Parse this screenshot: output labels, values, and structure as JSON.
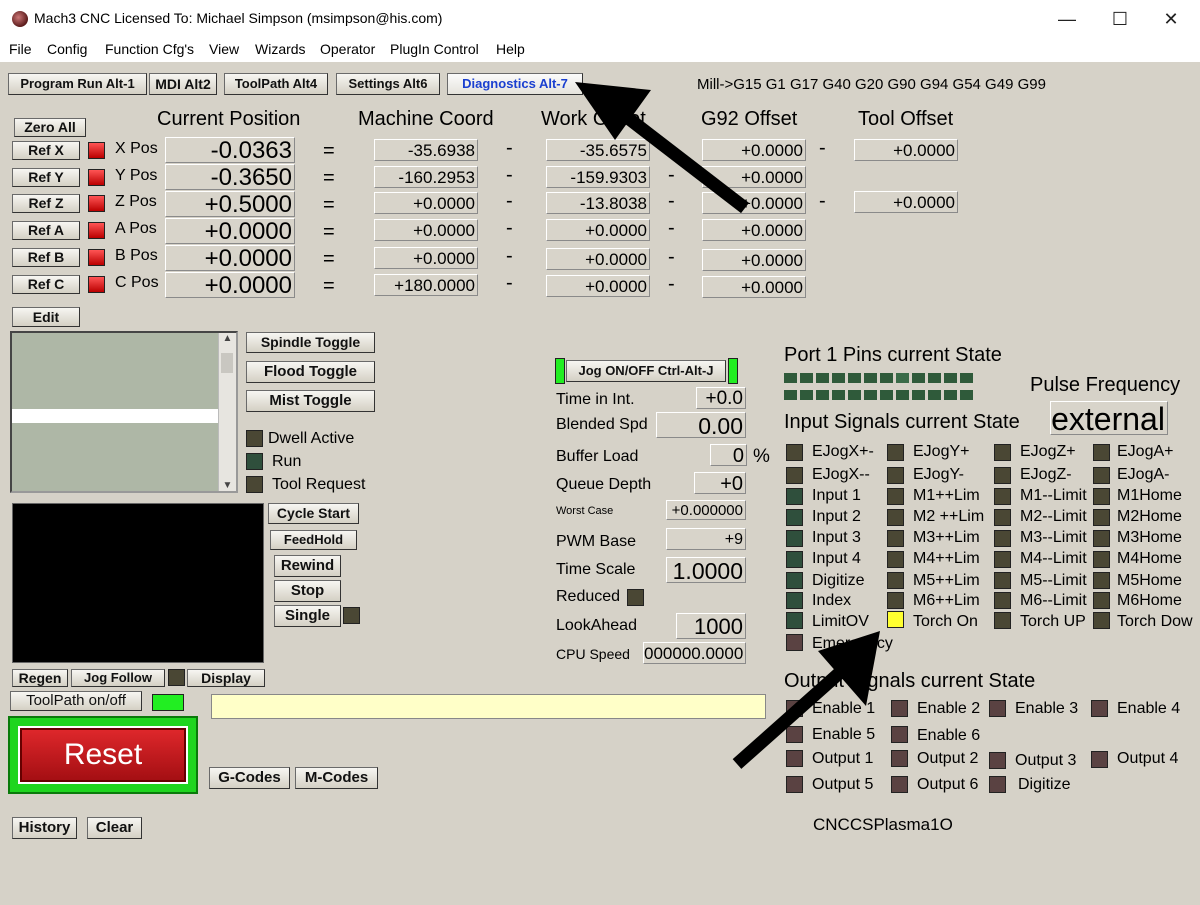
{
  "window": {
    "title": "Mach3 CNC  Licensed To:  Michael Simpson (msimpson@his.com)",
    "minimize": "—",
    "maximize": "☐",
    "close": "✕"
  },
  "menu": [
    "File",
    "Config",
    "Function Cfg's",
    "View",
    "Wizards",
    "Operator",
    "PlugIn Control",
    "Help"
  ],
  "tabs": [
    "Program Run Alt-1",
    "MDI Alt2",
    "ToolPath Alt4",
    "Settings Alt6",
    "Diagnostics Alt-7"
  ],
  "gcode_state": "Mill->G15  G1 G17 G40 G20 G90 G94 G54 G49 G99",
  "headers": {
    "current_position": "Current Position",
    "machine_coord": "Machine Coord",
    "work_offset": "Work Offset",
    "g92_offset": "G92 Offset",
    "tool_offset": "Tool Offset"
  },
  "zero_all": "Zero All",
  "axes": [
    {
      "ref": "Ref X",
      "label": "X Pos",
      "pos": "-0.0363",
      "machine": "-35.6938",
      "work": "-35.6575",
      "g92": "+0.0000",
      "tool": "+0.0000"
    },
    {
      "ref": "Ref Y",
      "label": "Y Pos",
      "pos": "-0.3650",
      "machine": "-160.2953",
      "work": "-159.9303",
      "g92": "+0.0000",
      "tool": ""
    },
    {
      "ref": "Ref Z",
      "label": "Z Pos",
      "pos": "+0.5000",
      "machine": "+0.0000",
      "work": "-13.8038",
      "g92": "+0.0000",
      "tool": "+0.0000"
    },
    {
      "ref": "Ref A",
      "label": "A Pos",
      "pos": "+0.0000",
      "machine": "+0.0000",
      "work": "+0.0000",
      "g92": "+0.0000",
      "tool": ""
    },
    {
      "ref": "Ref B",
      "label": "B Pos",
      "pos": "+0.0000",
      "machine": "+0.0000",
      "work": "+0.0000",
      "g92": "+0.0000",
      "tool": ""
    },
    {
      "ref": "Ref C",
      "label": "C Pos",
      "pos": "+0.0000",
      "machine": "+180.0000",
      "work": "+0.0000",
      "g92": "+0.0000",
      "tool": ""
    }
  ],
  "symbols": {
    "equals": "=",
    "minus": "-"
  },
  "edit": "Edit",
  "toggles": [
    "Spindle Toggle",
    "Flood Toggle",
    "Mist Toggle"
  ],
  "status_leds": [
    "Dwell Active",
    "Run",
    "Tool Request"
  ],
  "run_buttons": [
    "Cycle Start",
    "FeedHold",
    "Rewind",
    "Stop",
    "Single"
  ],
  "view_buttons": {
    "regen": "Regen",
    "jog_follow": "Jog Follow",
    "display": "Display"
  },
  "toolpath_onoff": "ToolPath on/off",
  "reset": "Reset",
  "gcodes": "G-Codes",
  "mcodes": "M-Codes",
  "history": "History",
  "clear": "Clear",
  "jog_button": "Jog ON/OFF Ctrl-Alt-J",
  "stats": [
    {
      "label": "Time in Int.",
      "value": "+0.0"
    },
    {
      "label": "Blended Spd",
      "value": "0.00"
    },
    {
      "label": "Buffer Load",
      "value": "0",
      "unit": "%"
    },
    {
      "label": "Queue Depth",
      "value": "+0"
    },
    {
      "label": "Worst Case",
      "value": "+0.000000"
    },
    {
      "label": "PWM Base",
      "value": "+9"
    },
    {
      "label": "Time Scale",
      "value": "1.0000"
    },
    {
      "label": "Reduced",
      "value": ""
    },
    {
      "label": "LookAhead",
      "value": "1000"
    },
    {
      "label": "CPU Speed",
      "value": "000000.0000"
    }
  ],
  "port1_title": "Port 1 Pins current State",
  "pulse_title": "Pulse Frequency",
  "pulse_value": "external",
  "input_title": "Input Signals current State",
  "input_signals": [
    [
      "EJogX+-",
      "EJogY+",
      "EJogZ+",
      "EJogA+"
    ],
    [
      "EJogX--",
      "EJogY-",
      "EJogZ-",
      "EJogA-"
    ],
    [
      "Input 1",
      "M1++Lim",
      "M1--Limit",
      "M1Home"
    ],
    [
      "Input 2",
      "M2 ++Lim",
      "M2--Limit",
      "M2Home"
    ],
    [
      "Input 3",
      "M3++Lim",
      "M3--Limit",
      "M3Home"
    ],
    [
      "Input 4",
      "M4++Lim",
      "M4--Limit",
      "M4Home"
    ],
    [
      "Digitize",
      "M5++Lim",
      "M5--Limit",
      "M5Home"
    ],
    [
      "Index",
      "M6++Lim",
      "M6--Limit",
      "M6Home"
    ],
    [
      "LimitOV",
      "Torch On",
      "Torch UP",
      "Torch Dow"
    ]
  ],
  "emergency": "Emergency",
  "output_title": "Output Signals current State",
  "output_signals": [
    [
      "Enable 1",
      "Enable 2",
      "Enable 3",
      "Enable 4"
    ],
    [
      "Enable 5",
      "Enable 6",
      "",
      ""
    ],
    [
      "Output 1",
      "Output 2",
      "Output 3",
      "Output 4"
    ],
    [
      "Output 5",
      "Output 6",
      "Digitize",
      ""
    ]
  ],
  "profile_name": "CNCCSPlasma1O",
  "colors": {
    "accent_blue": "#1a3fd0",
    "reset_red": "#c8161c",
    "led_yellow": "#ffff30",
    "led_green": "#22ee22"
  }
}
